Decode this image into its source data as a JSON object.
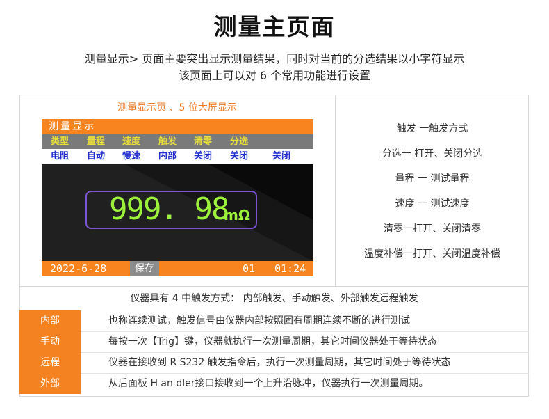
{
  "page": {
    "title": "测量主页面",
    "subtitle_line1": "测量显示> 页面主要突出显示测量结果，同时对当前的分选结果以小字符显示",
    "subtitle_line2": "该页面上可以对 6 个常用功能进行设置"
  },
  "panel_caption": "测量显示页 、5 位大屏显示",
  "device_screen": {
    "title": "测量显示",
    "headers": [
      "类型",
      "量程",
      "速度",
      "触发",
      "清零",
      "分选"
    ],
    "values": [
      "电阻",
      "自动",
      "慢速",
      "内部",
      "关闭",
      "关闭",
      "关闭"
    ],
    "reading": "999. 98",
    "unit": "mΩ",
    "status": {
      "date": "2022-6-28",
      "save_label": "保存",
      "page_no": "01",
      "time": "01:24"
    },
    "colors": {
      "bar_orange": "#f7841e",
      "header_text": "#e8de3c",
      "value_text": "#1f2dcc",
      "reading_green": "#9cf13a",
      "box_purple": "#7b55d2"
    }
  },
  "function_list": [
    "触发 一触发方式",
    "分选一 打开、关闭分选",
    "量程 一 测试量程",
    "速度 一 测试速度",
    "清零一打开、关闭清零",
    "温度补偿一打开、关闭温度补偿"
  ],
  "trigger_intro": "仪器具有 4 中触发方式： 内部触发、手动触发、外部触发远程触发",
  "trigger_table": [
    {
      "label": "内部",
      "desc": "也称连续测试，触发信号由仪器内部按照固有周期连续不断的进行测试"
    },
    {
      "label": "手动",
      "desc": "每按一次【Trig】键，仪器就执行一次测量周期，其它时间仪器处于等待状态"
    },
    {
      "label": "远程",
      "desc": "仪器在接收到 R S232 触发指令后，执行一次测量周期，其它时间处于等待状态"
    },
    {
      "label": "外部",
      "desc": "从后面板 H an dler接口接收到一个上升沿脉冲，仪器执行一次测量周期。"
    }
  ],
  "accent_color": "#f58220"
}
